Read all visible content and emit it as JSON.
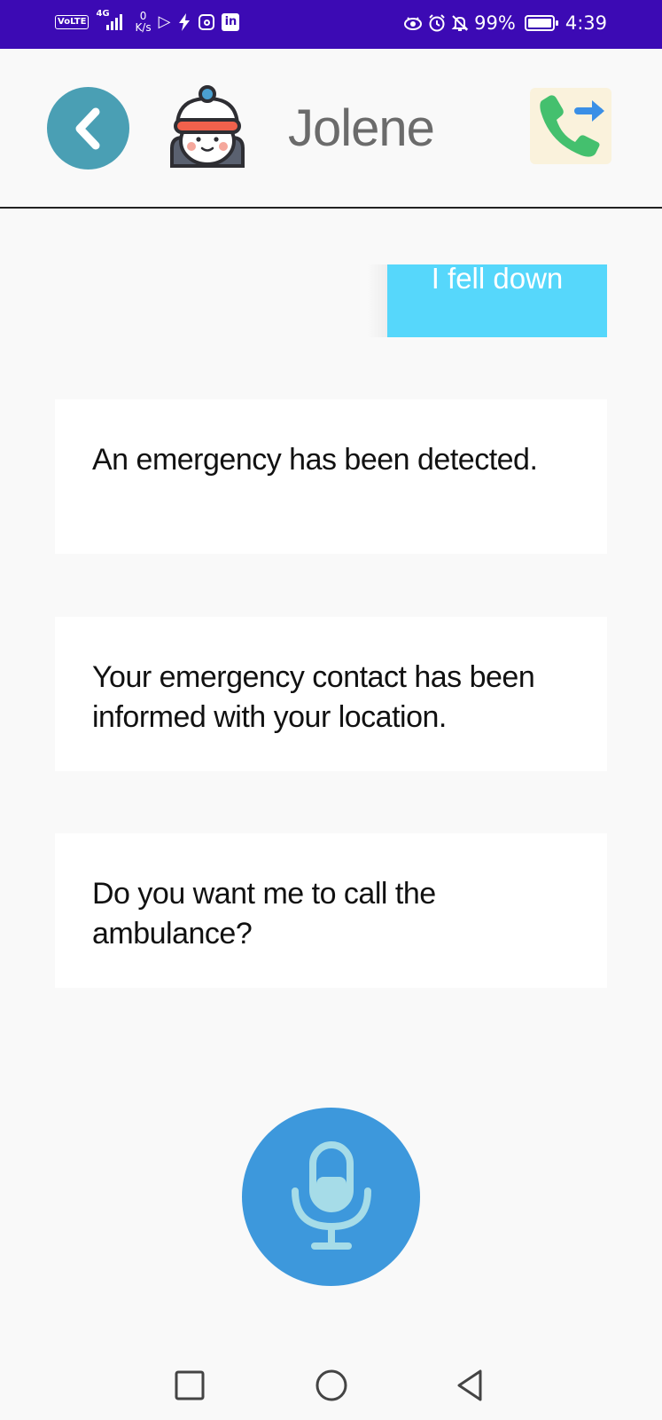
{
  "status_bar": {
    "volte": "VoLTE",
    "network": "4G",
    "speed_value": "0",
    "speed_unit": "K/s",
    "battery": "99%",
    "time": "4:39",
    "icons": [
      "play-store-icon",
      "flash-icon",
      "instagram-icon",
      "linkedin-icon",
      "eye-icon",
      "alarm-icon",
      "bell-off-icon",
      "battery-icon"
    ]
  },
  "header": {
    "contact_name": "Jolene",
    "back_icon": "chevron-left-icon",
    "call_icon": "call-forward-icon",
    "colors": {
      "back": "#4a9fb4",
      "name": "#6b6b6b"
    }
  },
  "chat": {
    "user_message": "I fell down",
    "bot_messages": [
      "An emergency has been detected.",
      "Your emergency contact has been informed with your location.",
      "Do you want me to call the ambulance?"
    ],
    "colors": {
      "user_bubble": "#56d7fb",
      "bot_card": "#ffffff"
    }
  },
  "mic": {
    "icon": "microphone-icon",
    "color": "#3d98dc"
  },
  "nav": {
    "icons": [
      "recents-icon",
      "home-icon",
      "back-icon"
    ]
  }
}
